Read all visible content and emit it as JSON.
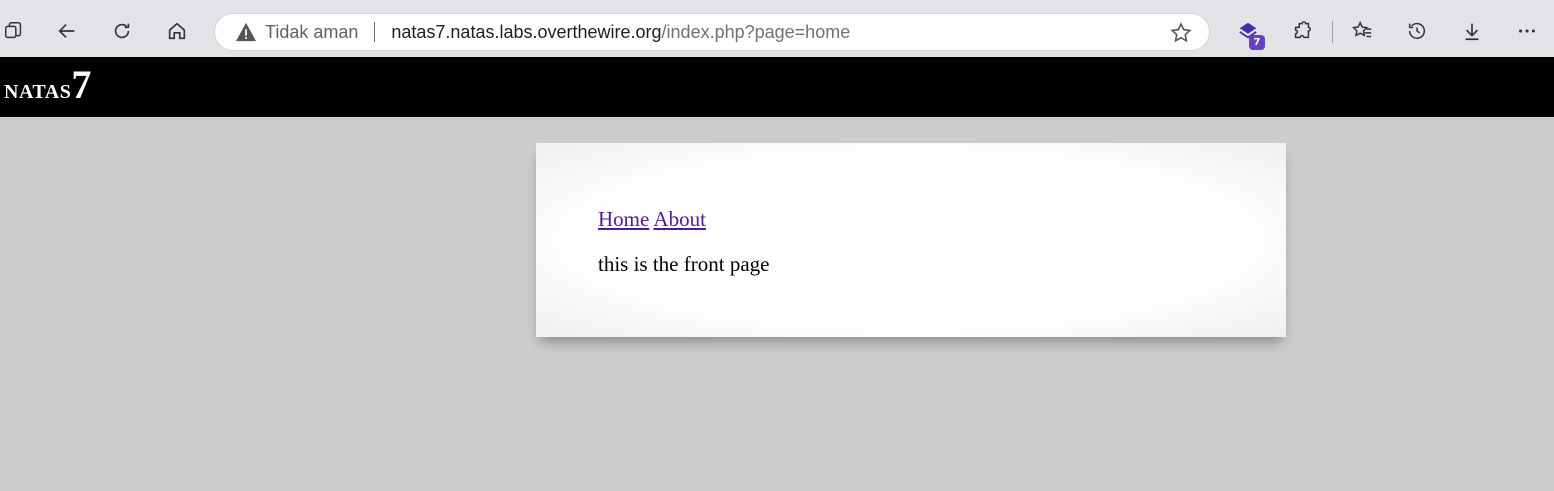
{
  "browser": {
    "security_label": "Tidak aman",
    "url_host": "natas7.natas.labs.overthewire.org",
    "url_path": "/index.php?page=home",
    "extension_badge": "7",
    "icons": [
      "tabs-icon",
      "back-icon",
      "refresh-icon",
      "home-icon",
      "warning-icon",
      "favorite-star-icon",
      "extension-icon",
      "extensions-icon",
      "favorites-icon",
      "history-icon",
      "downloads-icon",
      "more-icon"
    ]
  },
  "header": {
    "title_name": "natas",
    "title_num": "7"
  },
  "nav": {
    "home": "Home",
    "about": "About"
  },
  "content": {
    "text": "this is the front page"
  },
  "colors": {
    "page_bg": "#cccccc",
    "header_bg": "#000000",
    "link_visited": "#551a8b"
  }
}
